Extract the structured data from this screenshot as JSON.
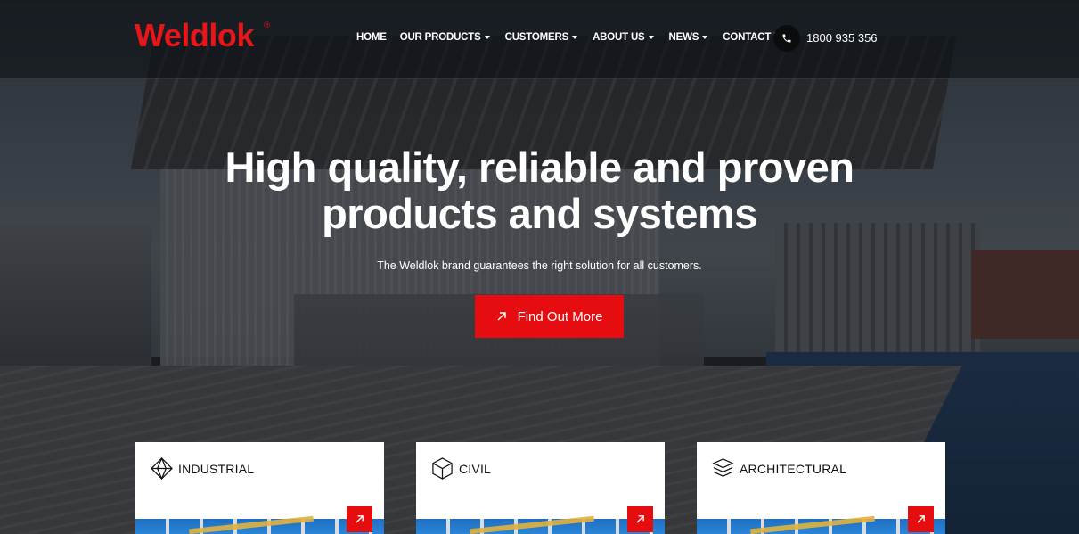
{
  "brand": {
    "logo_text": "Weldlok",
    "registered_mark": "®",
    "accent_color": "#e50d0f"
  },
  "nav": {
    "items": [
      {
        "label": "HOME",
        "has_dropdown": false
      },
      {
        "label": "OUR PRODUCTS",
        "has_dropdown": true
      },
      {
        "label": "CUSTOMERS",
        "has_dropdown": true
      },
      {
        "label": "ABOUT US",
        "has_dropdown": true
      },
      {
        "label": "NEWS",
        "has_dropdown": true
      },
      {
        "label": "CONTACT US",
        "has_dropdown": false
      }
    ]
  },
  "contact": {
    "phone_icon": "phone-icon",
    "phone_number": "1800 935 356"
  },
  "hero": {
    "title_line1": "High quality, reliable and proven",
    "title_line2": "products and systems",
    "subtitle": "The Weldlok brand guarantees the right solution for all customers.",
    "cta_label": "Find Out More",
    "cta_icon": "arrow-up-right-icon"
  },
  "cards": [
    {
      "label": "INDUSTRIAL",
      "icon": "diamond-gem-icon",
      "arrow_icon": "arrow-up-right-icon"
    },
    {
      "label": "CIVIL",
      "icon": "hexagon-cube-icon",
      "arrow_icon": "arrow-up-right-icon"
    },
    {
      "label": "ARCHITECTURAL",
      "icon": "layers-stack-icon",
      "arrow_icon": "arrow-up-right-icon"
    }
  ]
}
